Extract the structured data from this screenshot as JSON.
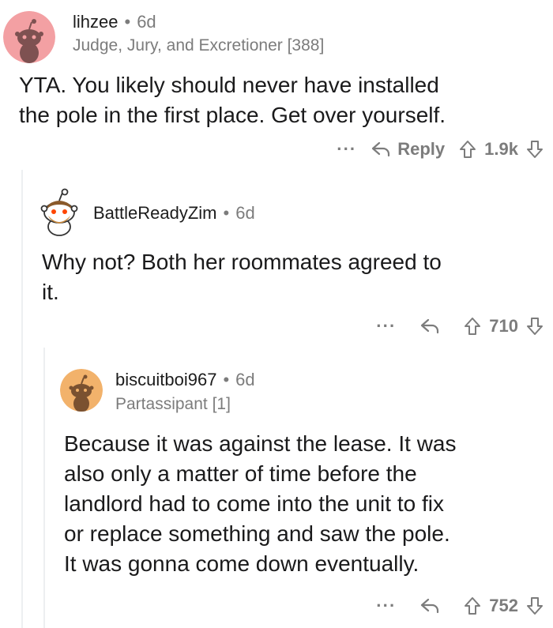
{
  "comments": [
    {
      "username": "lihzee",
      "separator": "•",
      "age": "6d",
      "flair": "Judge, Jury, and Excretioner [388]",
      "body_lines": [
        "YTA. You likely should never have installed",
        "the pole in the first place. Get over yourself."
      ],
      "more": "···",
      "reply_label": "Reply",
      "score": "1.9k"
    },
    {
      "username": "BattleReadyZim",
      "separator": "•",
      "age": "6d",
      "body_lines": [
        "Why not? Both her roommates agreed to",
        "it."
      ],
      "more": "···",
      "score": "710"
    },
    {
      "username": "biscuitboi967",
      "separator": "•",
      "age": "6d",
      "flair": "Partassipant [1]",
      "body_lines": [
        "Because it was against the lease. It was",
        "also only a matter of time before the",
        "landlord had to come into the unit to fix",
        "or replace something and saw the pole.",
        "It was gonna come down eventually."
      ],
      "more": "···",
      "score": "752"
    }
  ],
  "icons": {
    "reply": "reply-arrow-icon",
    "upvote": "upvote-icon",
    "downvote": "downvote-icon",
    "avatar": "snoo-avatar-icon"
  },
  "colors": {
    "meta_gray": "#7c7c7c",
    "text": "#1a1a1b",
    "avatar1_bg": "#f3a0a3",
    "avatar3_bg": "#f2b26b",
    "thread_line": "#edeff1"
  }
}
